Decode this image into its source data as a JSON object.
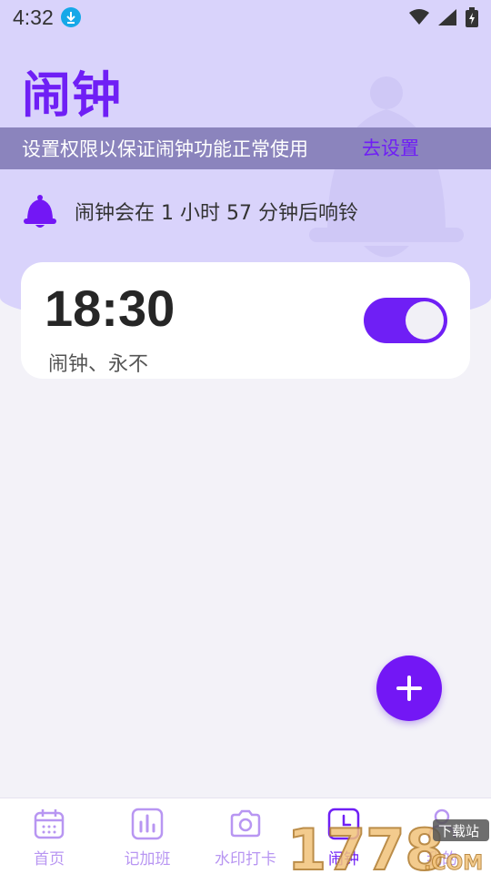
{
  "status": {
    "time": "4:32",
    "icons": [
      "download-icon",
      "wifi-icon",
      "signal-icon",
      "battery-icon"
    ]
  },
  "page": {
    "title": "闹钟"
  },
  "permission_banner": {
    "text": "设置权限以保证闹钟功能正常使用",
    "action_label": "去设置"
  },
  "next_ring": {
    "text": "闹钟会在 1 小时 57 分钟后响铃"
  },
  "alarms": [
    {
      "time": "18:30",
      "label": "闹钟、永不",
      "enabled": true
    }
  ],
  "nav": {
    "items": [
      {
        "label": "首页",
        "icon": "calendar-icon",
        "active": false
      },
      {
        "label": "记加班",
        "icon": "bar-chart-icon",
        "active": false
      },
      {
        "label": "水印打卡",
        "icon": "camera-icon",
        "active": false
      },
      {
        "label": "闹钟",
        "icon": "clock-icon",
        "active": true
      },
      {
        "label": "我的",
        "icon": "user-icon",
        "active": false
      }
    ]
  },
  "watermark": {
    "text": "1778",
    "suffix": ".COM",
    "badge": "下载站"
  },
  "colors": {
    "accent": "#6f1ff5",
    "header_bg": "#d9d3fb",
    "banner_bg": "#8b84bd",
    "page_bg": "#f3f2f8"
  }
}
